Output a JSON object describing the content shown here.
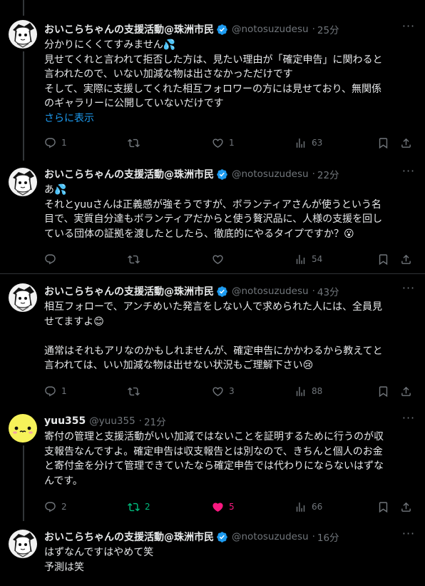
{
  "tweets": [
    {
      "author": "おいこらちゃんの支援活動@珠洲市民",
      "handle": "@notosuzudesu",
      "time": "25分",
      "avatar": "monochrome-character",
      "lines": [
        "分かりにくくてすみません💦",
        "見せてくれと言われて拒否した方は、見たい理由が「確定申告」に関わると",
        "言われたので、いない加減な物は出さなかっただけです",
        "そして、実際に支援してくれた相互フォロワーの方には見せており、無関係",
        "のギャラリーに公開していないだけです"
      ],
      "show_more": "さらに表示",
      "replies": "1",
      "retweets": "",
      "likes": "1",
      "views": "63"
    },
    {
      "author": "おいこらちゃんの支援活動@珠洲市民",
      "handle": "@notosuzudesu",
      "time": "22分",
      "avatar": "monochrome-character",
      "lines": [
        "あ💦",
        "それとyuuさんは正義感が強そうですが、ボランティアさんが使うという名",
        "目で、実質自分達もボランティアだからと使う贅沢品に、人様の支援を回し",
        "ている団体の証拠を渡したとしたら、徹底的にやるタイプですか？😮"
      ],
      "replies": "",
      "retweets": "",
      "likes": "",
      "views": "54"
    },
    {
      "author": "おいこらちゃんの支援活動@珠洲市民",
      "handle": "@notosuzudesu",
      "time": "43分",
      "avatar": "monochrome-character",
      "lines": [
        "相互フォローで、アンチめいた発言をしない人で求められた人には、全員見",
        "せてますよ😊",
        "",
        "通常はそれもアリなのかもしれませんが、確定申告にかかわるから教えてと",
        "言われては、いい加減な物は出せない状況もご理解下さい😢"
      ],
      "replies": "1",
      "retweets": "",
      "likes": "3",
      "views": "88"
    },
    {
      "author": "yuu355",
      "handle": "@yuu355",
      "time": "21分",
      "avatar": "yellow-emoji-face",
      "lines": [
        "寄付の管理と支援活動がいい加減ではないことを証明するために行うのが収",
        "支報告なんですよ。確定申告は収支報告とは別なので、きちんと個人のお金",
        "と寄付金を分けて管理できていたなら確定申告では代わりにならないはずな",
        "んです。"
      ],
      "replies": "2",
      "retweets": "2",
      "likes": "5",
      "views": "66"
    },
    {
      "author": "おいこらちゃんの支援活動@珠洲市民",
      "handle": "@notosuzudesu",
      "time": "16分",
      "avatar": "monochrome-character",
      "lines": [
        "はずなんですはやめて笑",
        "予測は笑"
      ]
    }
  ],
  "colors": {
    "background": "#000000",
    "text": "#e7e9ea",
    "muted": "#71767b",
    "accent": "#1d9bf0",
    "retweet_active": "#00ba7c",
    "like_active": "#f91880",
    "divider": "#2f3336"
  }
}
